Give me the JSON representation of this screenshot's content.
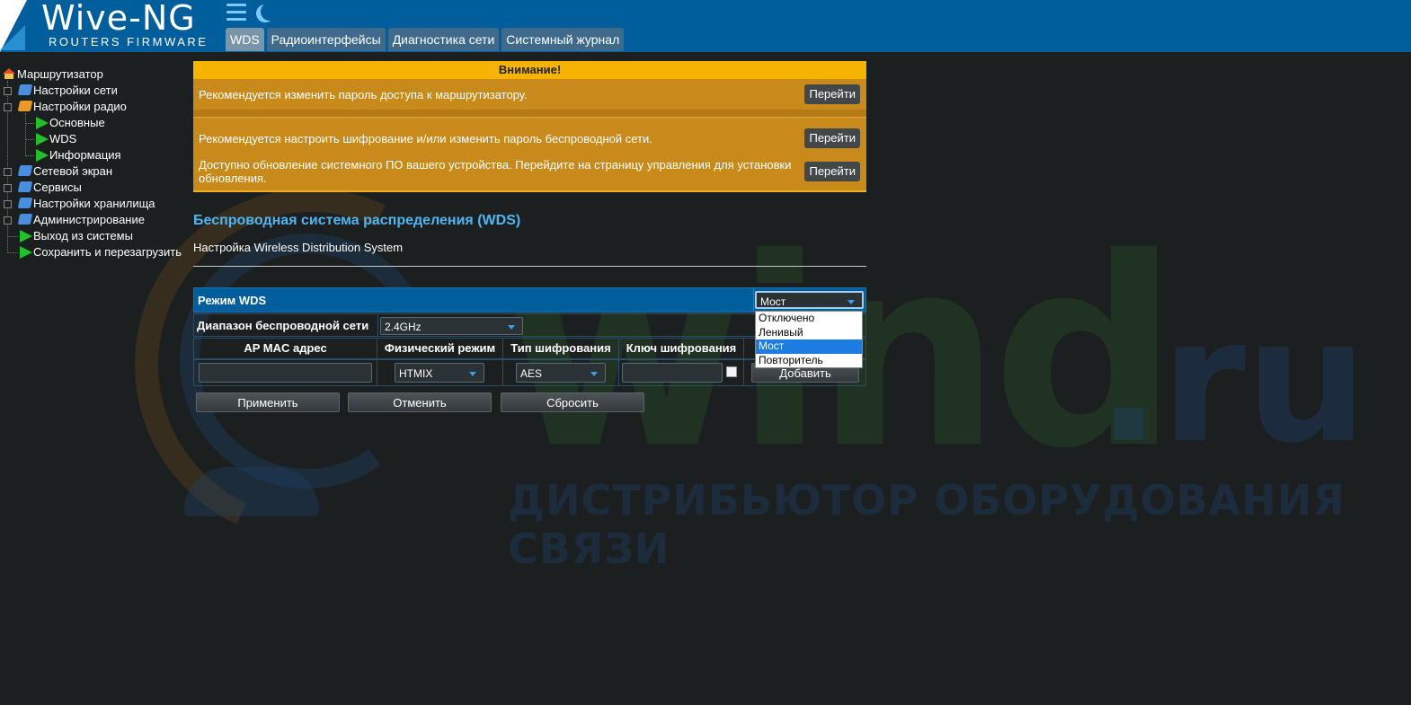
{
  "header": {
    "logo_name": "Wive-NG",
    "logo_sub": "ROUTERS FIRMWARE",
    "tabs": [
      {
        "label": "WDS",
        "active": true
      },
      {
        "label": "Радиоинтерфейсы",
        "active": false
      },
      {
        "label": "Диагностика сети",
        "active": false
      },
      {
        "label": "Системный журнал",
        "active": false
      }
    ]
  },
  "sidebar": {
    "root": "Маршрутизатор",
    "items": [
      {
        "label": "Настройки сети",
        "icon": "folder-icon"
      },
      {
        "label": "Настройки радио",
        "icon": "folder-open-icon"
      },
      {
        "label": "Основные",
        "icon": "page-arrow-icon"
      },
      {
        "label": "WDS",
        "icon": "page-arrow-icon"
      },
      {
        "label": "Информация",
        "icon": "page-arrow-icon"
      },
      {
        "label": "Сетевой экран",
        "icon": "folder-icon"
      },
      {
        "label": "Сервисы",
        "icon": "folder-icon"
      },
      {
        "label": "Настройки хранилища",
        "icon": "folder-icon"
      },
      {
        "label": "Администрирование",
        "icon": "folder-icon"
      },
      {
        "label": "Выход из системы",
        "icon": "page-arrow-icon"
      },
      {
        "label": "Сохранить и перезагрузить",
        "icon": "page-arrow-icon"
      }
    ]
  },
  "warning": {
    "title": "Внимание!",
    "messages": [
      "Рекомендуется изменить пароль доступа к маршрутизатору.",
      "Рекомендуется настроить шифрование и/или изменить пароль беспроводной сети.",
      "Доступно обновление системного ПО вашего устройства. Перейдите на страницу управления для установки обновления."
    ],
    "go_label": "Перейти"
  },
  "section": {
    "title": "Беспроводная система распределения (WDS)",
    "description": "Настройка Wireless Distribution System"
  },
  "wds": {
    "mode_label": "Режим WDS",
    "mode_value": "Мост",
    "mode_options": [
      "Отключено",
      "Ленивый",
      "Мост",
      "Повторитель"
    ],
    "mode_selected_index": 2,
    "band_label": "Диапазон беспроводной сети",
    "band_value": "2.4GHz",
    "columns": [
      "AP MAC адрес",
      "Физический режим",
      "Тип шифрования",
      "Ключ шифрования"
    ],
    "phy_mode_value": "HTMIX",
    "encryption_value": "AES",
    "mac_value": "",
    "key_value": "",
    "add_label": "Добавить"
  },
  "actions": {
    "apply": "Применить",
    "cancel": "Отменить",
    "reset": "Сбросить"
  },
  "watermark": {
    "brand": "wind",
    "tld": ".ru",
    "slogan": "ДИСТРИБЬЮТОР ОБОРУДОВАНИЯ СВЯЗИ"
  },
  "colors": {
    "header_bg": "#005e9c",
    "warning_bg": "#c88a1a",
    "warning_title_bg": "#f6b300",
    "title_accent": "#4fb6f2",
    "selected_option": "#1e7be0"
  }
}
